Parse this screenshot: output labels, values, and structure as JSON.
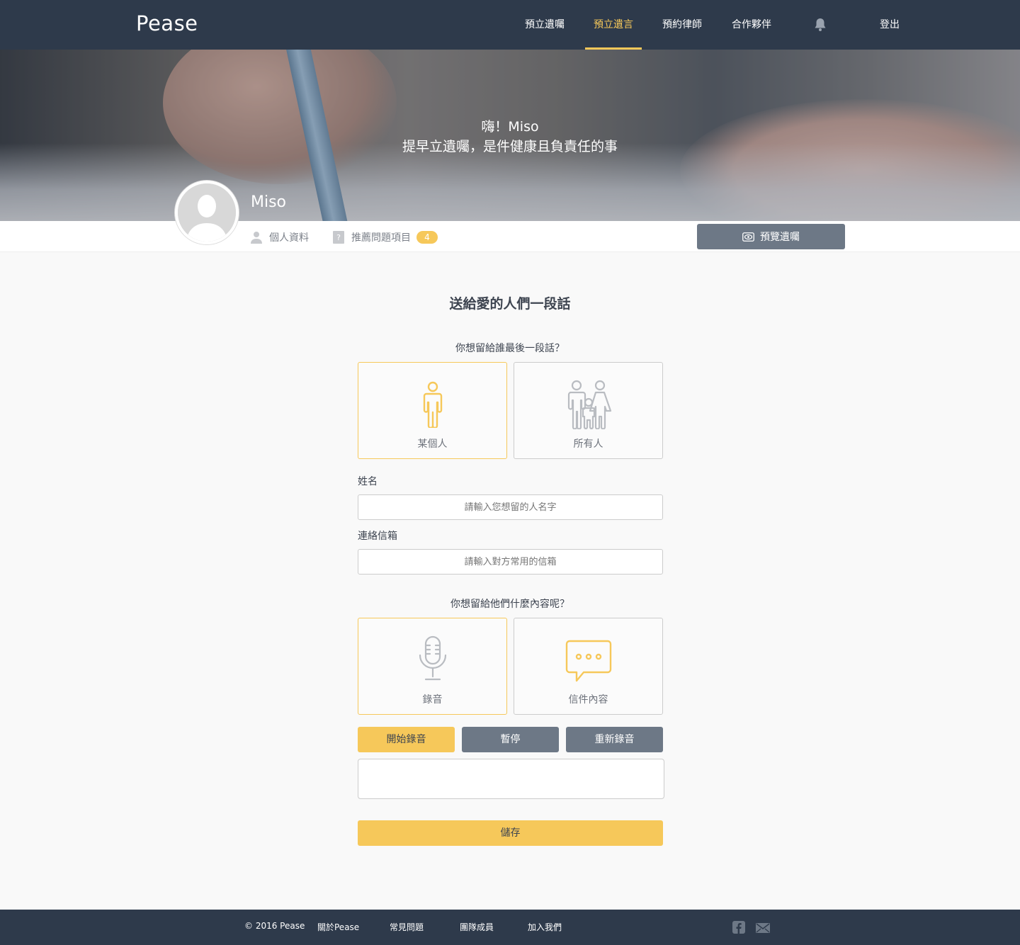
{
  "nav": {
    "logo": "Pease",
    "items": [
      "預立遺囑",
      "預立遺言",
      "預約律師",
      "合作夥伴"
    ],
    "active_index": 1,
    "bell_icon": "bell-icon",
    "logout": "登出"
  },
  "hero": {
    "greeting": "嗨！Miso",
    "tagline": "提早立遺囑，是件健康且負責任的事",
    "user_name": "Miso"
  },
  "profile": {
    "personal_info": "個人資料",
    "recommended": "推薦問題項目",
    "recommended_count": "4",
    "preview_button": "預覽遺囑"
  },
  "form": {
    "title": "送給愛的人們一段話",
    "q1": "你想留給誰最後一段話？",
    "recipient_options": [
      "某個人",
      "所有人"
    ],
    "recipient_selected": 0,
    "name_label": "姓名",
    "name_placeholder": "請輸入您想留的人名字",
    "email_label": "連絡信箱",
    "email_placeholder": "請輸入對方常用的信箱",
    "q2": "你想留給他們什麼內容呢？",
    "content_options": [
      "錄音",
      "信件內容"
    ],
    "content_selected": 0,
    "record_buttons": [
      "開始錄音",
      "暫停",
      "重新錄音"
    ],
    "save": "儲存"
  },
  "footer": {
    "copyright": "© 2016 Pease",
    "links": [
      "關於Pease",
      "常見問題",
      "團隊成員",
      "加入我們"
    ],
    "icons": [
      "facebook-icon",
      "mail-icon"
    ]
  },
  "colors": {
    "navy": "#2e3a4b",
    "accent": "#f6c85a",
    "gray_button": "#6d7886"
  }
}
